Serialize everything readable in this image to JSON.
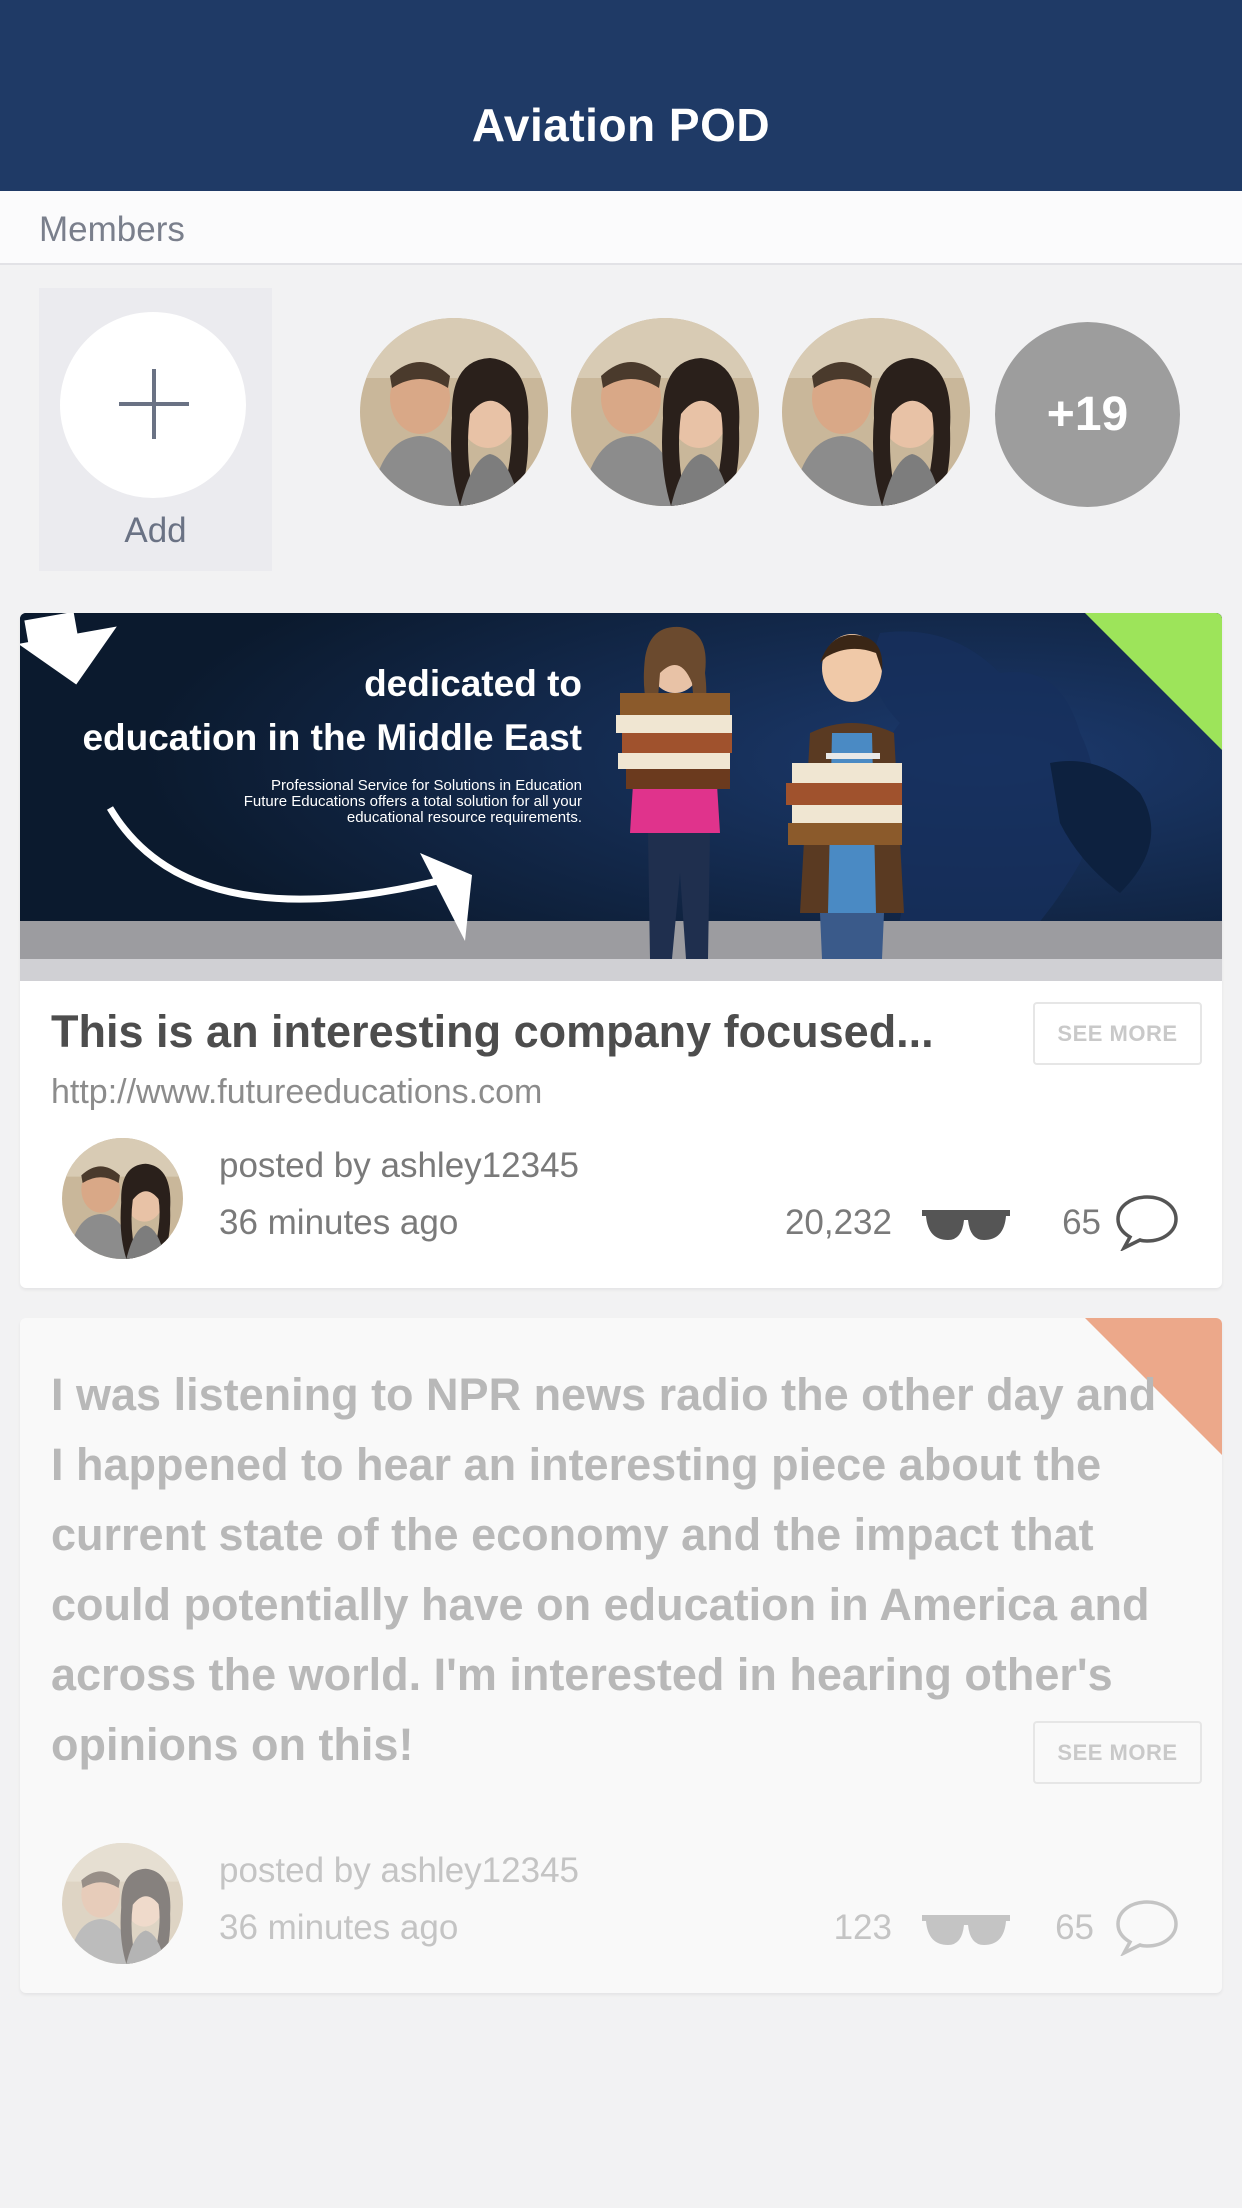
{
  "header": {
    "title": "Aviation POD"
  },
  "members": {
    "section_label": "Members",
    "add_label": "Add",
    "more_count": "+19"
  },
  "posts": [
    {
      "banner": {
        "headline_line1": "dedicated to",
        "headline_line2": "education in the Middle East",
        "sub_line1": "Professional Service for Solutions in Education",
        "sub_line2": "Future Educations offers a total solution for all your",
        "sub_line3": "educational resource requirements."
      },
      "title": "This is an interesting company focused...",
      "url": "http://www.futureeducations.com",
      "see_more": "SEE MORE",
      "posted_by": "posted by ashley12345",
      "time": "36 minutes ago",
      "views": "20,232",
      "comments": "65",
      "corner_color": "#9de45a"
    },
    {
      "body": "I was listening to NPR news radio the other day and I happened to hear an interesting piece about the current state of the economy and the impact that could potentially have on education in America and across the world. I'm interested in hearing other's opinions on this!",
      "see_more": "SEE MORE",
      "posted_by": "posted by ashley12345",
      "time": "36 minutes ago",
      "views": "123",
      "comments": "65",
      "corner_color": "#eca88a"
    }
  ],
  "icons": {
    "add": "plus-icon",
    "views": "sunglasses-icon",
    "comments": "speech-bubble-icon"
  },
  "colors": {
    "navbar": "#1f3a66",
    "background": "#f2f2f3"
  }
}
